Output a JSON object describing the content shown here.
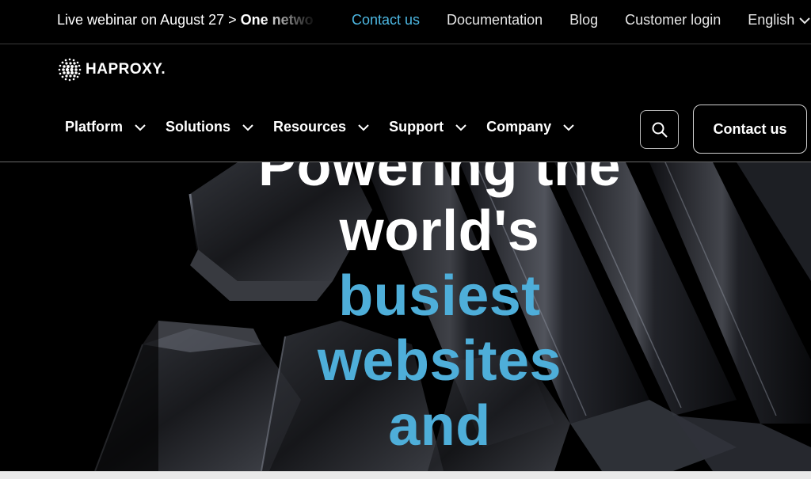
{
  "announcement": {
    "prefix": "Live webinar on August 27 > ",
    "bold": "One netwo"
  },
  "utility_links": {
    "contact": "Contact us",
    "docs": "Documentation",
    "blog": "Blog",
    "login": "Customer login",
    "language": "English"
  },
  "logo": {
    "text": "HAPROXY."
  },
  "nav": {
    "items": [
      {
        "label": "Platform"
      },
      {
        "label": "Solutions"
      },
      {
        "label": "Resources"
      },
      {
        "label": "Support"
      },
      {
        "label": "Company"
      }
    ],
    "search_icon": "search-icon",
    "contact_button": "Contact us"
  },
  "hero": {
    "line1": "Powering the",
    "line2": "world's",
    "line3": "busiest",
    "line4": "websites",
    "line5": "and"
  },
  "colors": {
    "accent": "#4db8e3",
    "hero_highlight": "#4eaed9",
    "background": "#000000"
  }
}
